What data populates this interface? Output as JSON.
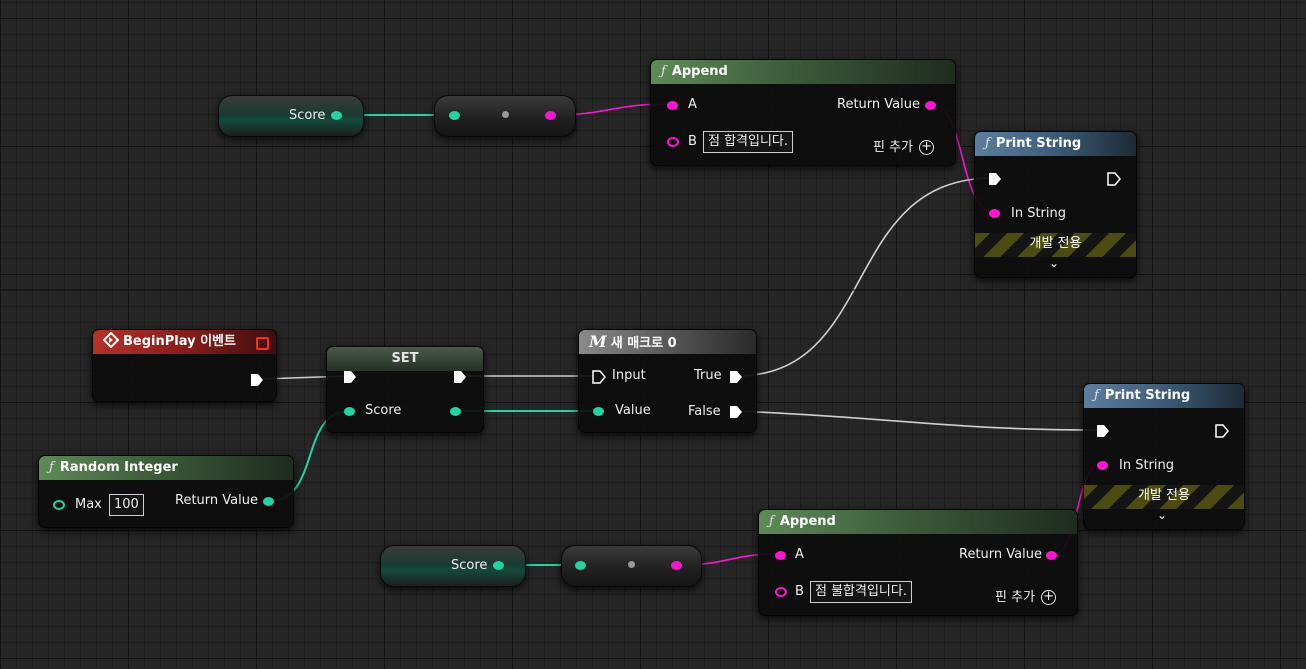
{
  "nodes": {
    "append_top": {
      "title": "Append",
      "pin_a": "A",
      "pin_b": "B",
      "b_value": "점 합격입니다.",
      "return_value": "Return Value",
      "add_pin": "핀 추가"
    },
    "append_bottom": {
      "title": "Append",
      "pin_a": "A",
      "pin_b": "B",
      "b_value": "점 불합격입니다.",
      "return_value": "Return Value",
      "add_pin": "핀 추가"
    },
    "print_top": {
      "title": "Print String",
      "in_string": "In String",
      "dev_only": "개발 전용"
    },
    "print_bottom": {
      "title": "Print String",
      "in_string": "In String",
      "dev_only": "개발 전용"
    },
    "begin_play": {
      "title": "BeginPlay 이벤트"
    },
    "set_node": {
      "title": "SET",
      "score": "Score"
    },
    "macro": {
      "title": "새 매크로 0",
      "input": "Input",
      "value": "Value",
      "true_label": "True",
      "false_label": "False"
    },
    "random_integer": {
      "title": "Random Integer",
      "max": "Max",
      "max_value": "100",
      "return_value": "Return Value"
    },
    "score_var_top": {
      "label": "Score"
    },
    "score_var_bottom": {
      "label": "Score"
    }
  },
  "icons": {
    "function": "ƒ",
    "macro": "M",
    "event": "event-diamond-icon",
    "add": "+"
  },
  "colors": {
    "string_pin": "#ff14d2",
    "int_pin": "#1fd6a2",
    "exec_wire": "#cfcfcf"
  }
}
